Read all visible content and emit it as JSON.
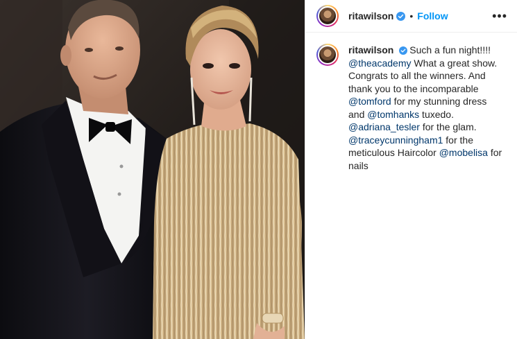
{
  "post": {
    "username": "ritawilson",
    "follow_label": "Follow",
    "separator": "•",
    "more_label": "•••"
  },
  "caption": {
    "username": "ritawilson",
    "segments": [
      {
        "text": "Such a fun night!!!! ",
        "mention": false
      },
      {
        "text": "@theacademy",
        "mention": true
      },
      {
        "text": " What a great show. Congrats to all the winners. And thank you to the incomparable ",
        "mention": false
      },
      {
        "text": "@tomford",
        "mention": true
      },
      {
        "text": " for my stunning dress and ",
        "mention": false
      },
      {
        "text": "@tomhanks",
        "mention": true
      },
      {
        "text": " tuxedo. ",
        "mention": false
      },
      {
        "text": "@adriana_tesler",
        "mention": true
      },
      {
        "text": " for the glam. ",
        "mention": false
      },
      {
        "text": "@traceycunningham1",
        "mention": true
      },
      {
        "text": " for the meticulous Haircolor ",
        "mention": false
      },
      {
        "text": "@mobelisa",
        "mention": true
      },
      {
        "text": " for nails",
        "mention": false
      }
    ]
  },
  "icons": {
    "verified": "verified-badge-icon",
    "more": "more-options-icon"
  },
  "colors": {
    "accent": "#0095f6",
    "mention": "#00376b",
    "text": "#262626",
    "verified": "#3897f0"
  }
}
